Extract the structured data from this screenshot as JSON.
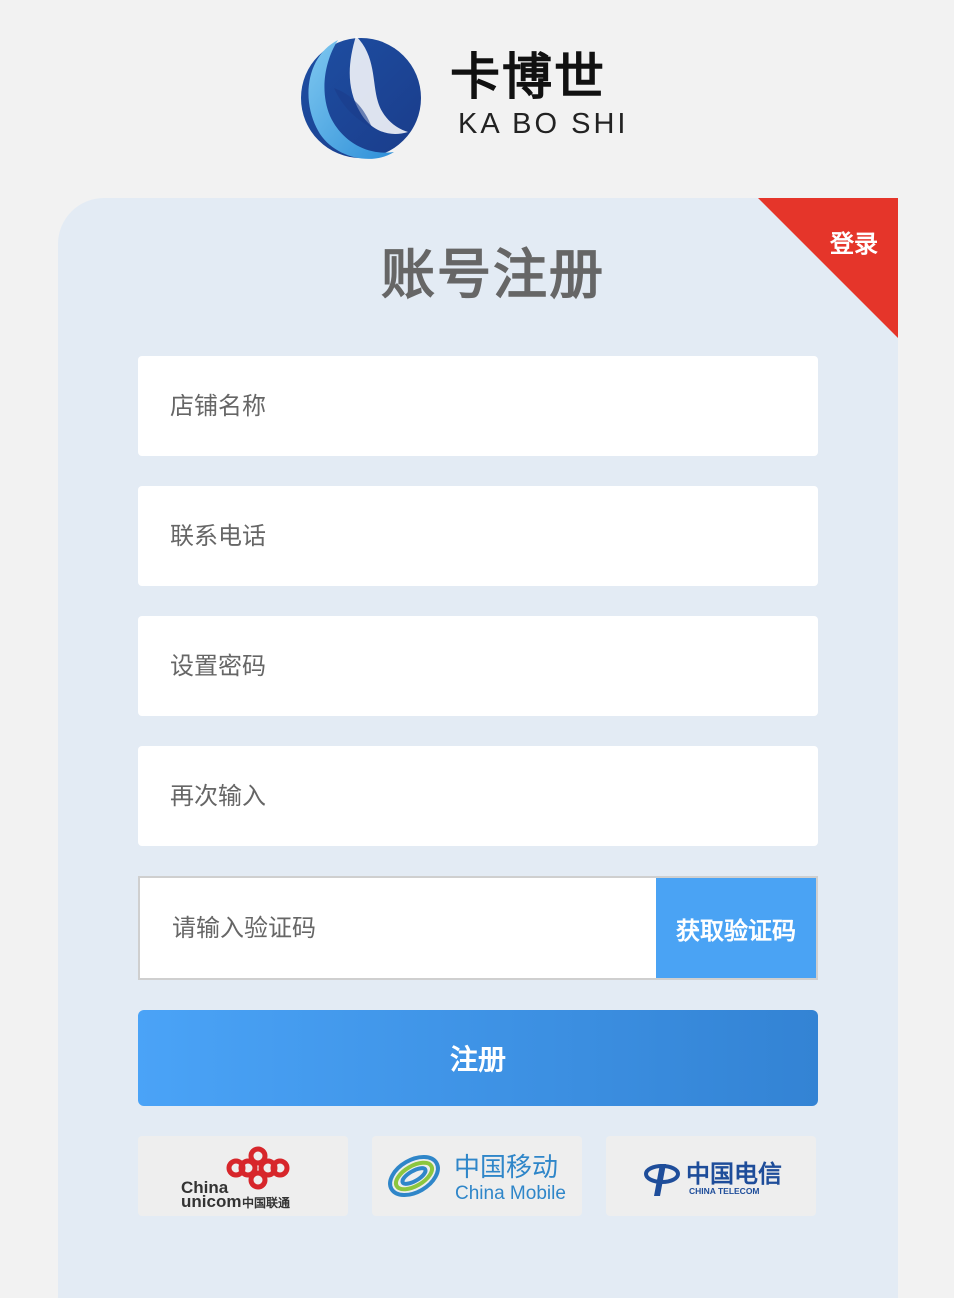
{
  "brand": {
    "name_cn": "卡博世",
    "name_en": "KA BO SHI"
  },
  "form": {
    "title": "账号注册",
    "login_label": "登录",
    "fields": [
      {
        "placeholder": "店铺名称"
      },
      {
        "placeholder": "联系电话"
      },
      {
        "placeholder": "设置密码"
      },
      {
        "placeholder": "再次输入"
      }
    ],
    "code": {
      "placeholder": "请输入验证码",
      "button_label": "获取验证码"
    },
    "submit_label": "注册"
  },
  "carriers": {
    "unicom": {
      "en1": "China",
      "en2": "unicom",
      "cn": "中国联通",
      "icon": "china-unicom-knot"
    },
    "mobile": {
      "cn": "中国移动",
      "en": "China Mobile",
      "icon": "china-mobile-swirl"
    },
    "telecom": {
      "cn": "中国电信",
      "en": "CHINA TELECOM",
      "icon": "china-telecom-e"
    }
  },
  "colors": {
    "accent": "#4aa3f4",
    "corner": "#e5352a",
    "card_bg": "#e3ebf4",
    "page_bg": "#f2f2f2"
  }
}
